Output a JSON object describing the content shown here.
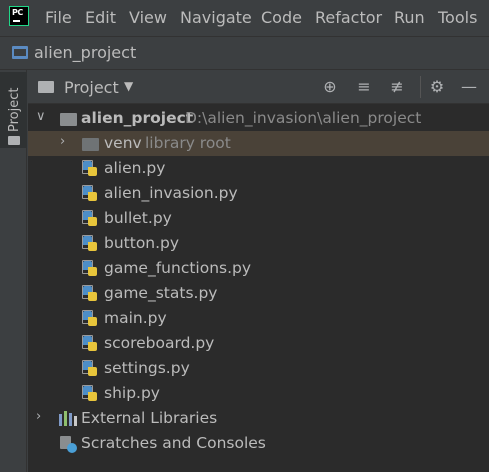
{
  "menu": {
    "items": [
      "File",
      "Edit",
      "View",
      "Navigate",
      "Code",
      "Refactor",
      "Run",
      "Tools"
    ]
  },
  "app_logo_text": "PC",
  "breadcrumb": "alien_project",
  "stripe": {
    "label": "Project"
  },
  "panel": {
    "title": "Project",
    "tools": [
      "locate-icon",
      "expand-all-icon",
      "collapse-all-icon",
      "gear-icon",
      "minimize-icon"
    ]
  },
  "tree": {
    "root": {
      "name": "alien_project",
      "path": "D:\\alien_invasion\\alien_project"
    },
    "venv": {
      "name": "venv",
      "note": "library root"
    },
    "files": [
      "alien.py",
      "alien_invasion.py",
      "bullet.py",
      "button.py",
      "game_functions.py",
      "game_stats.py",
      "main.py",
      "scoreboard.py",
      "settings.py",
      "ship.py"
    ],
    "external_libraries": "External Libraries",
    "scratches": "Scratches and Consoles"
  },
  "colors": {
    "background": "#3c3f41",
    "tree_background": "#2b2b2b",
    "selection": "#4a4238",
    "python_blue": "#4d8ec7",
    "python_yellow": "#e8c53b"
  }
}
